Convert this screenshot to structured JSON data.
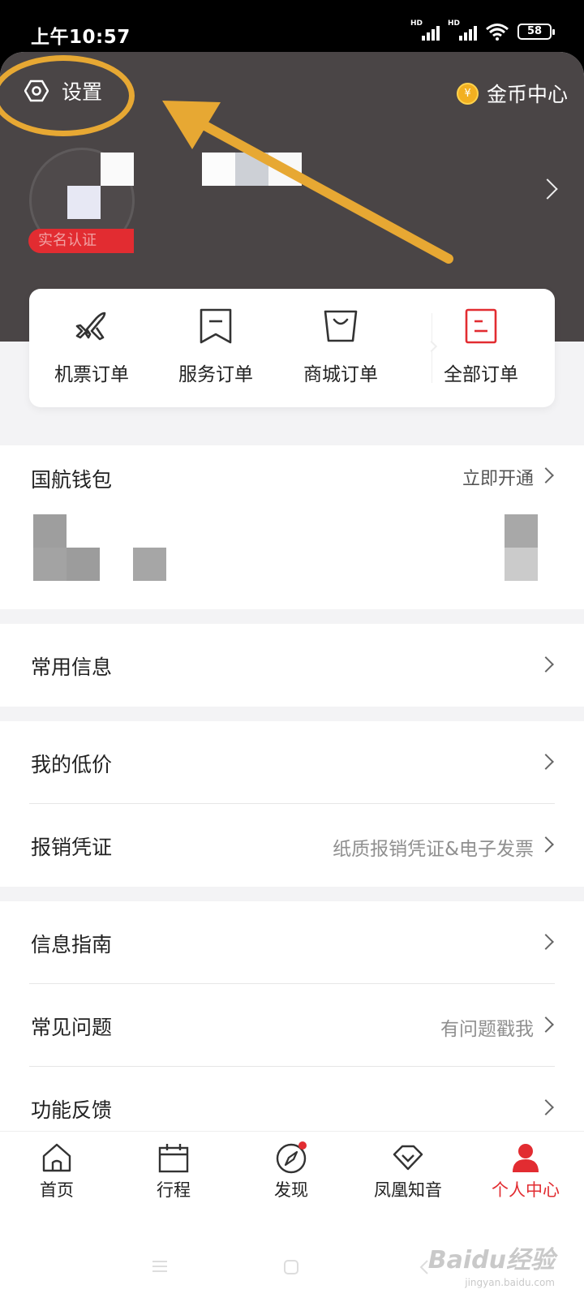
{
  "status_bar": {
    "time": "上午10:57",
    "battery": "58",
    "signal_labels": [
      "HD",
      "HD"
    ]
  },
  "header": {
    "settings_label": "设置",
    "gold_center_label": "金币中心",
    "coin_symbol": "¥",
    "verify_badge": "实名认证"
  },
  "orders": {
    "items": [
      {
        "label": "机票订单",
        "icon": "airplane-icon"
      },
      {
        "label": "服务订单",
        "icon": "bookmark-icon"
      },
      {
        "label": "商城订单",
        "icon": "shopping-bag-icon"
      },
      {
        "label": "全部订单",
        "icon": "document-icon"
      }
    ]
  },
  "wallet": {
    "title": "国航钱包",
    "action": "立即开通"
  },
  "menu": {
    "common_info": {
      "title": "常用信息"
    },
    "my_low_price": {
      "title": "我的低价"
    },
    "reimbursement": {
      "title": "报销凭证",
      "hint": "纸质报销凭证&电子发票"
    },
    "info_guide": {
      "title": "信息指南"
    },
    "faq": {
      "title": "常见问题",
      "hint": "有问题戳我"
    },
    "feedback": {
      "title": "功能反馈"
    }
  },
  "tabbar": {
    "tabs": [
      {
        "label": "首页",
        "icon": "home-icon"
      },
      {
        "label": "行程",
        "icon": "calendar-icon"
      },
      {
        "label": "发现",
        "icon": "compass-icon"
      },
      {
        "label": "凤凰知音",
        "icon": "diamond-icon"
      },
      {
        "label": "个人中心",
        "icon": "person-icon"
      }
    ],
    "active_index": 4
  },
  "watermark": {
    "main": "Baidu经验",
    "sub": "jingyan.baidu.com"
  },
  "colors": {
    "accent_red": "#e22c31",
    "header_bg": "#4a4546",
    "annotation_gold": "#e7a833",
    "coin_gold": "#f2b021"
  }
}
